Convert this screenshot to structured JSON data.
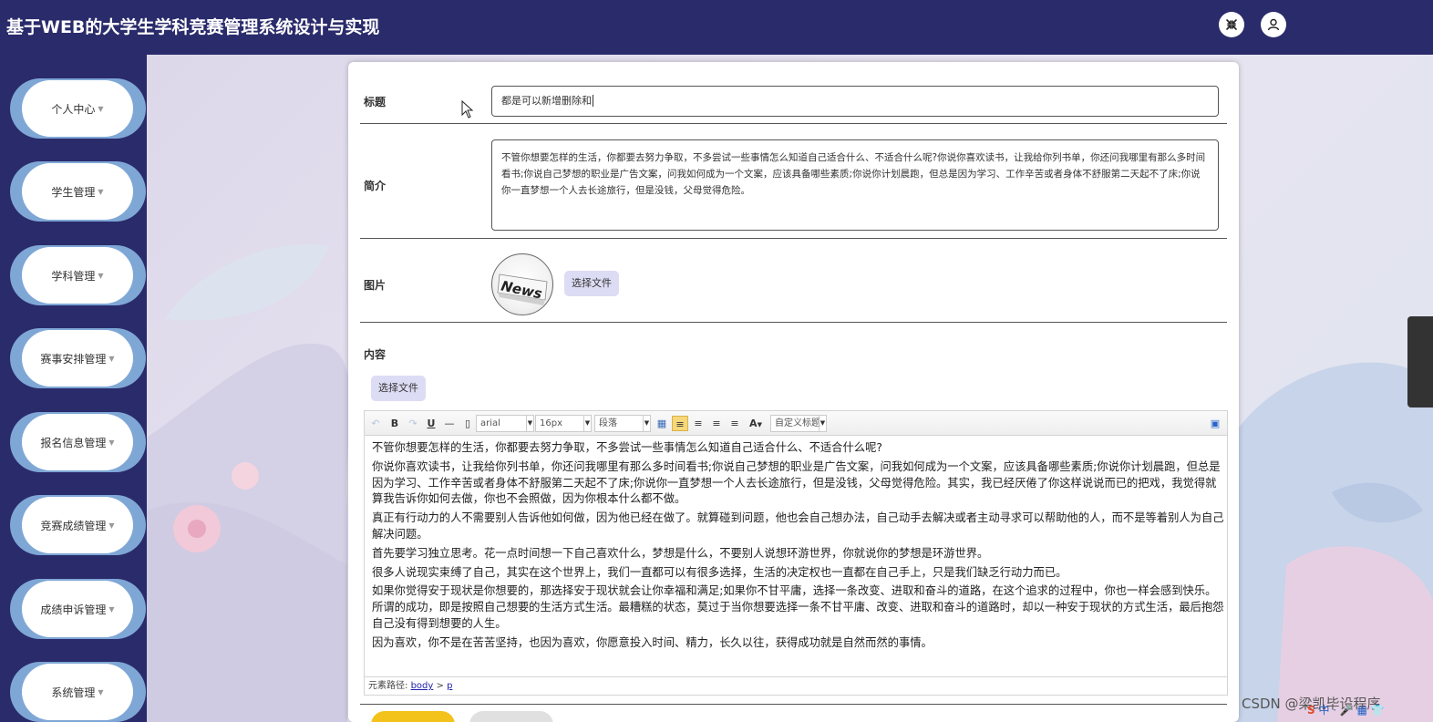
{
  "header": {
    "app_title": "基于WEB的大学生学科竞赛管理系统设计与实现",
    "fullscreen_icon": "fullscreen-exit-icon",
    "user_icon": "user-icon"
  },
  "sidebar": {
    "items": [
      {
        "label": "个人中心"
      },
      {
        "label": "学生管理"
      },
      {
        "label": "学科管理"
      },
      {
        "label": "赛事安排管理"
      },
      {
        "label": "报名信息管理"
      },
      {
        "label": "竞赛成绩管理"
      },
      {
        "label": "成绩申诉管理"
      },
      {
        "label": "系统管理"
      }
    ]
  },
  "form": {
    "title_label": "标题",
    "title_value": "都是可以新增删除和",
    "summary_label": "简介",
    "summary_value": "不管你想要怎样的生活，你都要去努力争取，不多尝试一些事情怎么知道自己适合什么、不适合什么呢?你说你喜欢读书，让我给你列书单，你还问我哪里有那么多时间看书;你说自己梦想的职业是广告文案，问我如何成为一个文案，应该具备哪些素质;你说你计划晨跑，但总是因为学习、工作辛苦或者身体不舒服第二天起不了床;你说你一直梦想一个人去长途旅行，但是没钱，父母觉得危险。",
    "image_label": "图片",
    "image_text": "News",
    "image_file_button": "选择文件",
    "content_label": "内容",
    "content_file_button": "选择文件"
  },
  "editor": {
    "toolbar": {
      "bold": "B",
      "italic": "I",
      "underline": "U",
      "font_family": "arial",
      "font_size": "16px",
      "paragraph": "段落",
      "font_color": "A",
      "custom_title": "自定义标题"
    },
    "paragraphs": [
      "不管你想要怎样的生活，你都要去努力争取，不多尝试一些事情怎么知道自己适合什么、不适合什么呢?",
      "你说你喜欢读书，让我给你列书单，你还问我哪里有那么多时间看书;你说自己梦想的职业是广告文案，问我如何成为一个文案，应该具备哪些素质;你说你计划晨跑，但总是因为学习、工作辛苦或者身体不舒服第二天起不了床;你说你一直梦想一个人去长途旅行，但是没钱，父母觉得危险。其实，我已经厌倦了你这样说说而已的把戏，我觉得就算我告诉你如何去做，你也不会照做，因为你根本什么都不做。",
      "真正有行动力的人不需要别人告诉他如何做，因为他已经在做了。就算碰到问题，他也会自己想办法，自己动手去解决或者主动寻求可以帮助他的人，而不是等着别人为自己解决问题。",
      "首先要学习独立思考。花一点时间想一下自己喜欢什么，梦想是什么，不要别人说想环游世界，你就说你的梦想是环游世界。",
      "很多人说现实束缚了自己，其实在这个世界上，我们一直都可以有很多选择，生活的决定权也一直都在自己手上，只是我们缺乏行动力而已。",
      "如果你觉得安于现状是你想要的，那选择安于现状就会让你幸福和满足;如果你不甘平庸，选择一条改变、进取和奋斗的道路，在这个追求的过程中，你也一样会感到快乐。所谓的成功，即是按照自己想要的生活方式生活。最糟糕的状态，莫过于当你想要选择一条不甘平庸、改变、进取和奋斗的道路时，却以一种安于现状的方式生活，最后抱怨自己没有得到想要的人生。",
      "因为喜欢，你不是在苦苦坚持，也因为喜欢，你愿意投入时间、精力，长久以往，获得成功就是自然而然的事情。"
    ],
    "element_path_label": "元素路径:",
    "element_path_body": "body",
    "element_path_sep": ">",
    "element_path_p": "p"
  },
  "overlay": {
    "watermark": "CSDN @梁凯毕设程序",
    "ime_text": "中 · 🎤 ▦ 👕"
  },
  "colors": {
    "header_bg": "#2a2b6b",
    "nav_blob": "#7fa7d6",
    "file_button_bg": "#dcdcf5",
    "submit_button": "#f3c21b",
    "cancel_button": "#e0e0e0"
  }
}
